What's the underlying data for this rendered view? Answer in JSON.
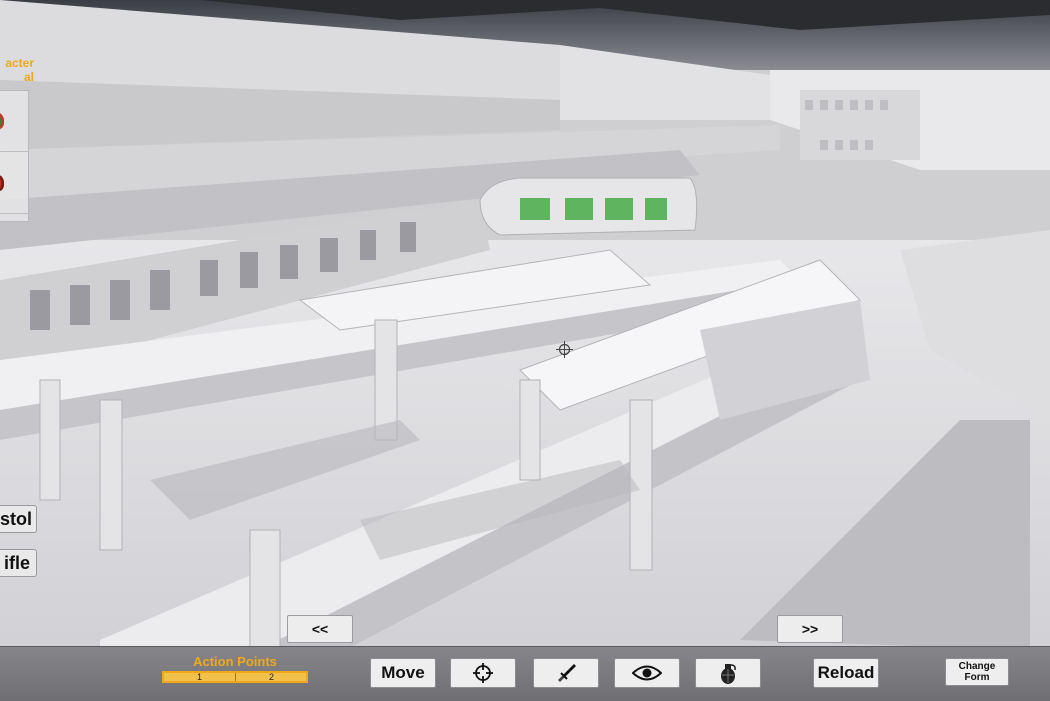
{
  "character_panel": {
    "header_line1": "acter",
    "header_line2": "al",
    "portraits": [
      {
        "color": "#3b7d3b",
        "accent": "#c23a2a"
      },
      {
        "color": "#c23a2a",
        "accent": "#7a1a12"
      }
    ]
  },
  "weapons": {
    "pistol_label": "stol",
    "rifle_label": "ifle"
  },
  "navigation": {
    "prev_label": "<<",
    "next_label": ">>"
  },
  "action_bar": {
    "ap_label": "Action Points",
    "ap_segments": [
      "1",
      "2"
    ],
    "move_label": "Move",
    "aim_icon": "crosshair-icon",
    "melee_icon": "knife-icon",
    "overwatch_icon": "eye-icon",
    "grenade_icon": "grenade-icon",
    "reload_label": "Reload",
    "change_form_line1": "Change",
    "change_form_line2": "Form"
  },
  "colors": {
    "accent": "#f0a818",
    "button_bg": "#eeeeef",
    "bar_bg": "#7b7b7f"
  }
}
